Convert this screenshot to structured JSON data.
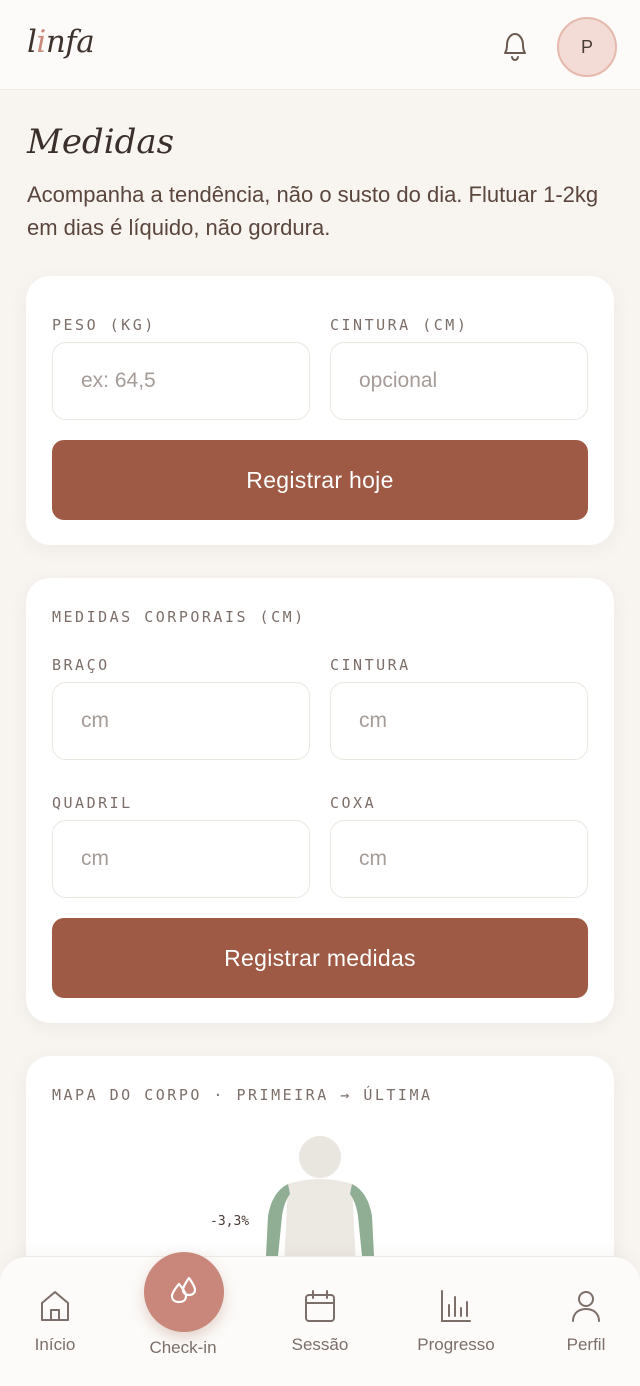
{
  "header": {
    "logo_l": "l",
    "logo_i": "i",
    "logo_rest": "nfa",
    "avatar_initial": "P"
  },
  "page": {
    "title": "Medidas",
    "subtitle": "Acompanha a tendência, não o susto do dia. Flutuar 1-2kg em dias é líquido, não gordura."
  },
  "weight_card": {
    "weight_label": "PESO (KG)",
    "weight_placeholder": "ex: 64,5",
    "waist_label": "CINTURA (CM)",
    "waist_placeholder": "opcional",
    "submit_label": "Registrar hoje"
  },
  "body_card": {
    "section_label": "MEDIDAS CORPORAIS (CM)",
    "arm_label": "BRAÇO",
    "arm_placeholder": "cm",
    "waist_label": "CINTURA",
    "waist_placeholder": "cm",
    "hip_label": "QUADRIL",
    "hip_placeholder": "cm",
    "thigh_label": "COXA",
    "thigh_placeholder": "cm",
    "submit_label": "Registrar medidas"
  },
  "map_card": {
    "section_label": "MAPA DO CORPO · PRIMEIRA → ÚLTIMA",
    "arm_change": "-3,3%",
    "colors": {
      "arm": "#8fae93",
      "body": "#ece8e2",
      "head": "#e9e5df"
    }
  },
  "nav": {
    "items": [
      {
        "label": "Início",
        "icon": "home-icon"
      },
      {
        "label": "Check-in",
        "icon": "drops-icon"
      },
      {
        "label": "Sessão",
        "icon": "calendar-icon"
      },
      {
        "label": "Progresso",
        "icon": "bar-chart-icon"
      },
      {
        "label": "Perfil",
        "icon": "user-icon"
      }
    ]
  },
  "colors": {
    "accent": "#9e5a44",
    "checkin": "#c8877a",
    "background": "#f8f5f1"
  }
}
